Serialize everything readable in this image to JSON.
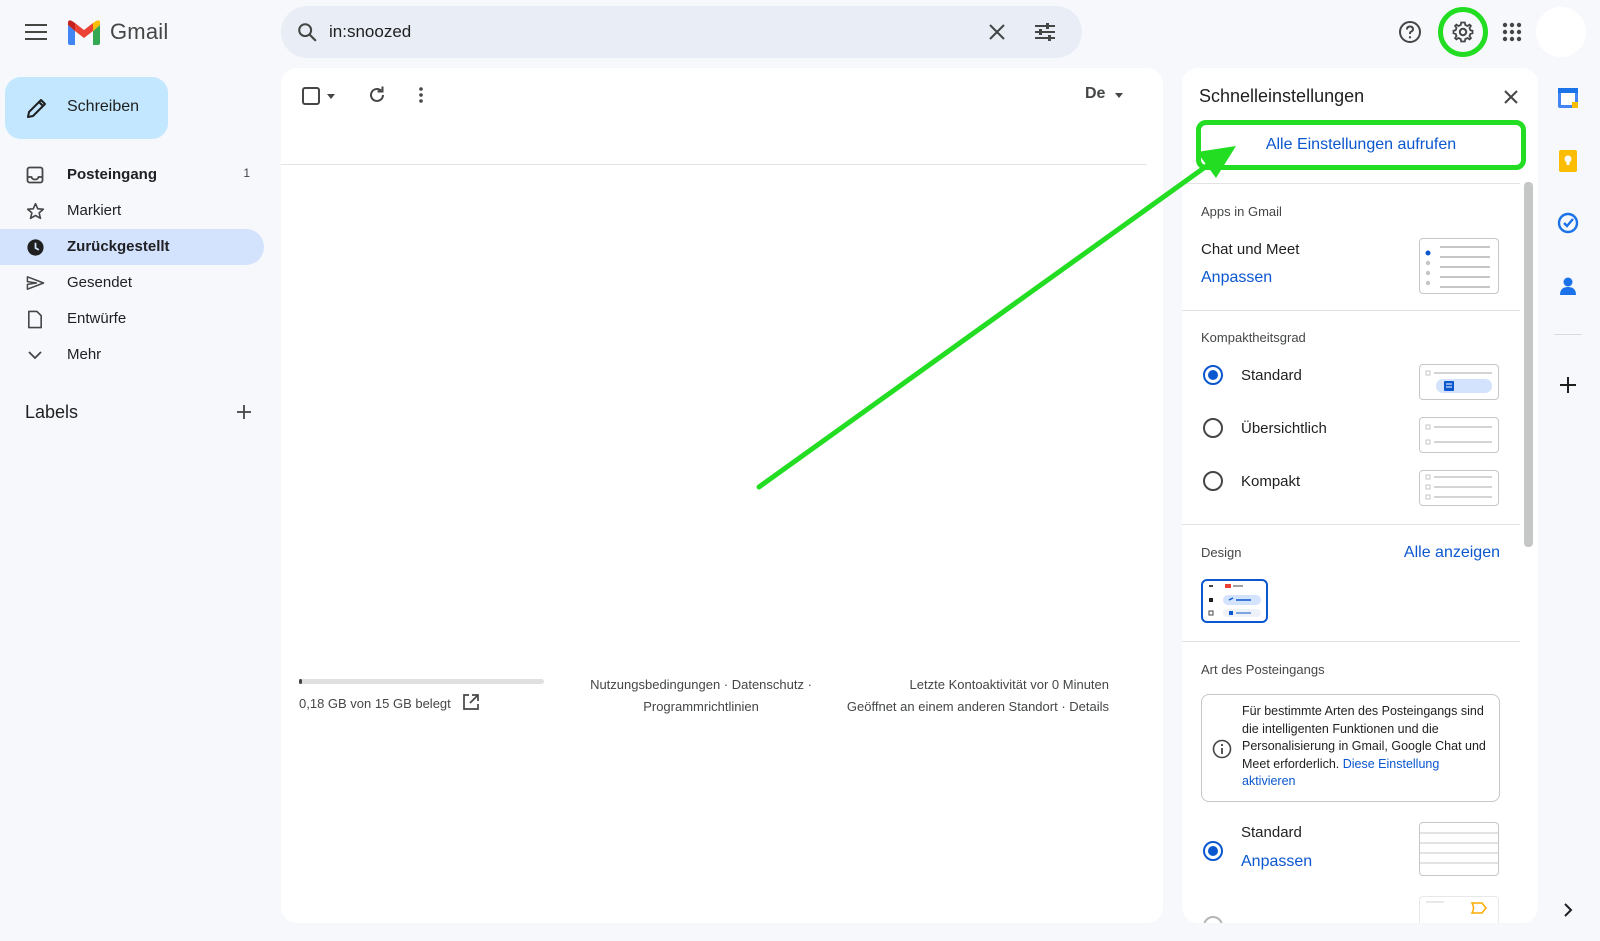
{
  "app": {
    "name": "Gmail"
  },
  "search": {
    "query": "in:snoozed"
  },
  "compose": {
    "label": "Schreiben"
  },
  "nav": {
    "items": [
      {
        "label": "Posteingang",
        "count": "1"
      },
      {
        "label": "Markiert"
      },
      {
        "label": "Zurückgestellt"
      },
      {
        "label": "Gesendet"
      },
      {
        "label": "Entwürfe"
      },
      {
        "label": "Mehr"
      }
    ],
    "labels_heading": "Labels"
  },
  "toolbar": {
    "lang": "De"
  },
  "footer": {
    "storage_text": "0,18 GB von 15 GB belegt",
    "storage_used_fraction": 0.012,
    "terms": "Nutzungsbedingungen · Datenschutz ·",
    "policies": "Programmrichtlinien",
    "activity": "Letzte Kontoaktivität vor 0 Minuten",
    "activity_detail": "Geöffnet an einem anderen Standort · Details"
  },
  "quick_settings": {
    "title": "Schnelleinstellungen",
    "all_settings": "Alle Einstellungen aufrufen",
    "apps_heading": "Apps in Gmail",
    "chat_meet": "Chat und Meet",
    "customize": "Anpassen",
    "density_heading": "Kompaktheitsgrad",
    "density_options": [
      "Standard",
      "Übersichtlich",
      "Kompakt"
    ],
    "density_selected": "Standard",
    "theme_heading": "Design",
    "theme_show_all": "Alle anzeigen",
    "inbox_heading": "Art des Posteingangs",
    "inbox_info": "Für bestimmte Arten des Posteingangs sind die intelligenten Funktionen und die Personalisierung in Gmail, Google Chat und Meet erforderlich. ",
    "inbox_info_link": "Diese Einstellung aktivieren",
    "inbox_standard": "Standard",
    "inbox_customize": "Anpassen"
  },
  "colors": {
    "highlight": "#22dd22",
    "accent": "#0b57d0",
    "nav_active": "#d3e3fd",
    "compose": "#c2e7ff"
  }
}
